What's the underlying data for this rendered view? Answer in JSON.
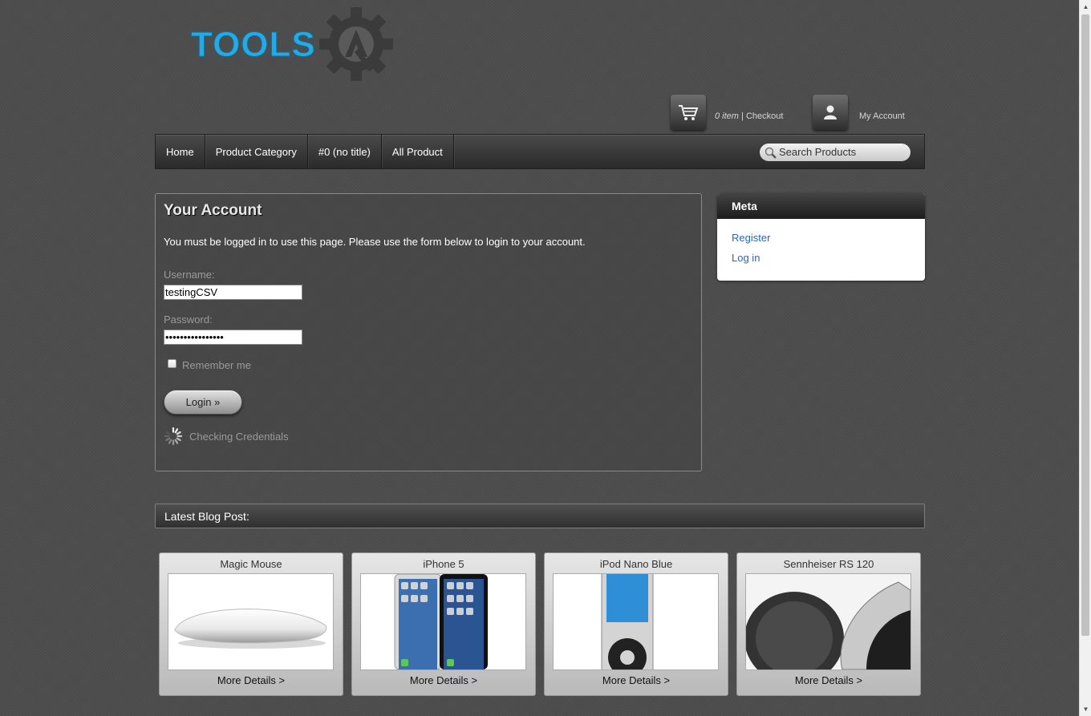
{
  "logo": {
    "text": "TOOLS",
    "brand_color": "#2aa8e0"
  },
  "header": {
    "cart_count": "0 item",
    "separator": "|",
    "checkout_label": "Checkout",
    "account_label": "My Account"
  },
  "nav": {
    "items": [
      {
        "label": "Home"
      },
      {
        "label": "Product Category"
      },
      {
        "label": "#0 (no title)"
      },
      {
        "label": "All Product"
      }
    ],
    "search_placeholder": "Search Products"
  },
  "account": {
    "title": "Your Account",
    "intro": "You must be logged in to use this page. Please use the form below to login to your account.",
    "username_label": "Username:",
    "username_value": "testingCSV",
    "password_label": "Password:",
    "password_value": "testingcsv123456",
    "remember_label": "Remember me",
    "login_label": "Login »",
    "checking_label": "Checking Credentials"
  },
  "meta": {
    "title": "Meta",
    "links": [
      {
        "label": "Register"
      },
      {
        "label": "Log in"
      }
    ]
  },
  "blog": {
    "title": "Latest Blog Post:",
    "products": [
      {
        "title": "Magic Mouse",
        "more": "More Details >"
      },
      {
        "title": "iPhone 5",
        "more": "More Details >"
      },
      {
        "title": "iPod Nano Blue",
        "more": "More Details >"
      },
      {
        "title": "Sennheiser RS 120",
        "more": "More Details >"
      }
    ]
  }
}
